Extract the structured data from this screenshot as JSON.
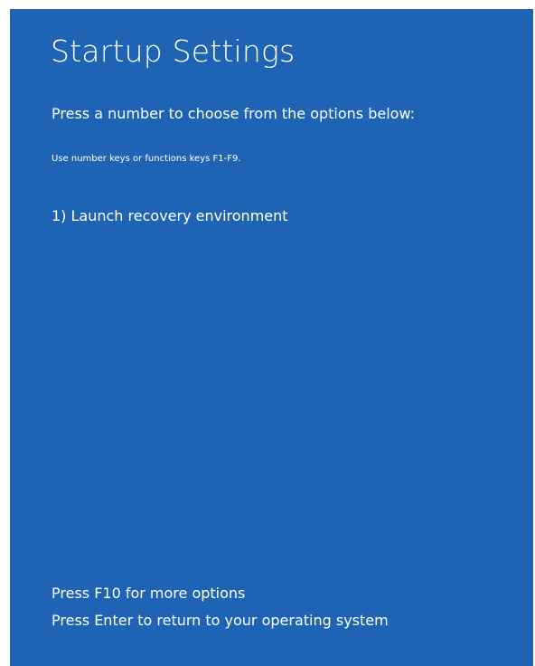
{
  "screen": {
    "title": "Startup Settings",
    "subtitle": "Press a number to choose from the options below:",
    "hint": "Use number keys or functions keys F1-F9.",
    "options": [
      {
        "label": "1) Launch recovery environment"
      }
    ],
    "footer": {
      "more_options": "Press F10 for more options",
      "return": "Press Enter to return to your operating system"
    }
  },
  "colors": {
    "background": "#1f64b4",
    "text": "#ffffff"
  }
}
